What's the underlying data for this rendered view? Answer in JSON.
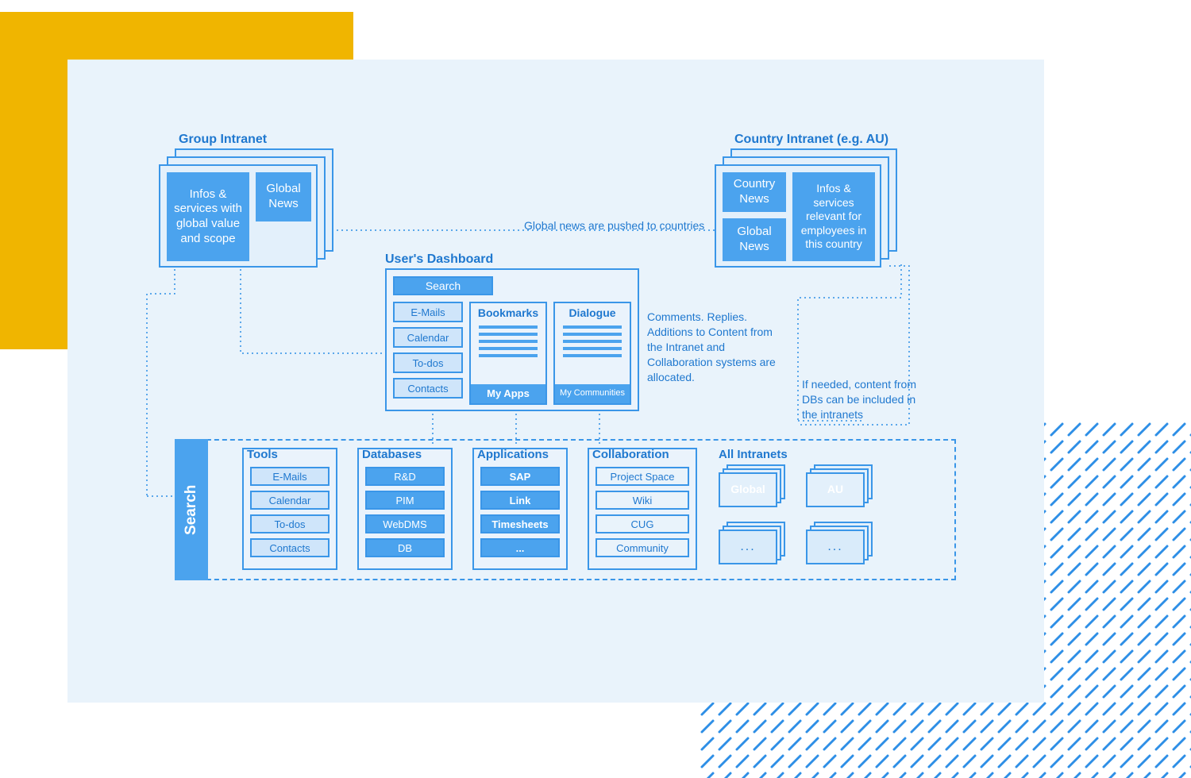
{
  "group_intranet": {
    "title": "Group Intranet",
    "info_card": "Infos & services with global value and scope",
    "news_card": "Global News"
  },
  "country_intranet": {
    "title": "Country Intranet (e.g. AU)",
    "country_news": "Country News",
    "global_news": "Global News",
    "info_card": "Infos & services relevant for employees in this country"
  },
  "dashboard": {
    "title": "User's Dashboard",
    "search": "Search",
    "col1": [
      "E-Mails",
      "Calendar",
      "To-dos",
      "Contacts"
    ],
    "col2_title": "Bookmarks",
    "col2_footer": "My Apps",
    "col3_title": "Dialogue",
    "col3_footer": "My Communities"
  },
  "notes": {
    "push": "Global news are pushed to countries",
    "allocate": "Comments. Replies. Additions to Content from the Intranet and Collaboration systems are allocated.",
    "db": "If needed, content from DBs can be included in the intranets"
  },
  "bottom": {
    "search": "Search",
    "columns": [
      {
        "title": "Tools",
        "items": [
          "E-Mails",
          "Calendar",
          "To-dos",
          "Contacts"
        ],
        "style": "light"
      },
      {
        "title": "Databases",
        "items": [
          "R&D",
          "PIM",
          "WebDMS",
          "DB"
        ],
        "style": "fill"
      },
      {
        "title": "Applications",
        "items": [
          "SAP",
          "Link",
          "Timesheets",
          "..."
        ],
        "style": "fill-bold"
      },
      {
        "title": "Collaboration",
        "items": [
          "Project Space",
          "Wiki",
          "CUG",
          "Community"
        ],
        "style": "hollow"
      }
    ],
    "all_intranets": {
      "title": "All Intranets",
      "global": "Global",
      "au": "AU",
      "more": "..."
    }
  }
}
